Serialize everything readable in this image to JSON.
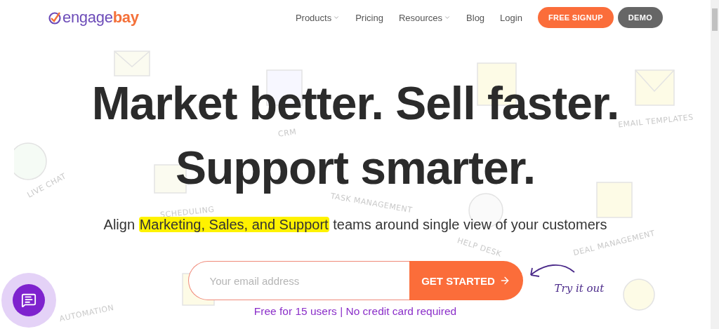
{
  "logo": {
    "prefix": "engage",
    "suffix": "bay"
  },
  "nav": {
    "items": [
      {
        "label": "Products",
        "dropdown": true
      },
      {
        "label": "Pricing",
        "dropdown": false
      },
      {
        "label": "Resources",
        "dropdown": true
      },
      {
        "label": "Blog",
        "dropdown": false
      },
      {
        "label": "Login",
        "dropdown": false
      }
    ],
    "buttons": [
      {
        "label": "FREE SIGNUP",
        "kind": "primary"
      },
      {
        "label": "DEMO",
        "kind": "secondary"
      }
    ]
  },
  "background_labels": [
    "CRM",
    "EMAIL TEMPLATES",
    "LIVE CHAT",
    "TASK MANAGEMENT",
    "SCHEDULING",
    "HELP DESK",
    "DEAL MANAGEMENT",
    "AUTOMATION"
  ],
  "hero": {
    "headline_lines": [
      "Market better. Sell faster.",
      "Support smarter."
    ],
    "subtitle": {
      "before": "Align",
      "highlight": "Marketing, Sales, and Support",
      "after": "teams around single view of your customers"
    },
    "signup_form": {
      "placeholder": "Your email address",
      "button": "GET STARTED"
    },
    "callout": "Try it out",
    "note": "Free for 15 users | No credit card required"
  }
}
